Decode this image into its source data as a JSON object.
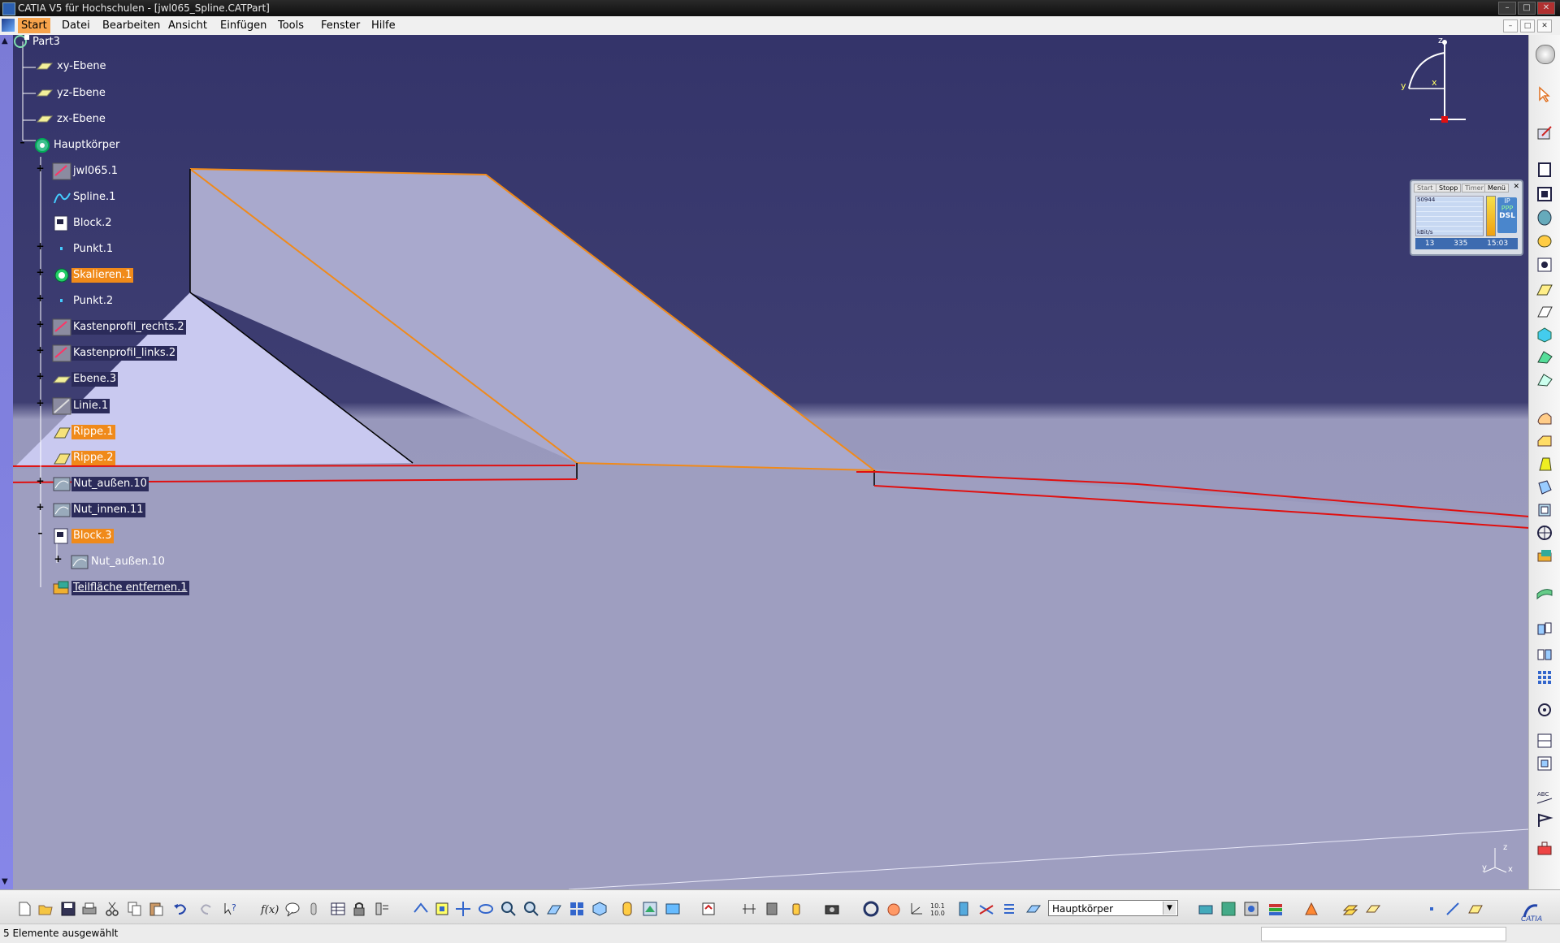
{
  "window": {
    "title": "CATIA V5 für Hochschulen - [jwl065_Spline.CATPart]",
    "controls": [
      "–",
      "□",
      "✕"
    ]
  },
  "menu": {
    "items": [
      "Start",
      "Datei",
      "Bearbeiten",
      "Ansicht",
      "Einfügen",
      "Tools",
      "Fenster",
      "Hilfe"
    ],
    "active": "Start",
    "mdi_controls": [
      "–",
      "□",
      "✕"
    ]
  },
  "tree": {
    "root": "Part3",
    "nodes": [
      {
        "label": "xy-Ebene",
        "icon": "plane-icon",
        "style": "plain"
      },
      {
        "label": "yz-Ebene",
        "icon": "plane-icon",
        "style": "plain"
      },
      {
        "label": "zx-Ebene",
        "icon": "plane-icon",
        "style": "plain"
      },
      {
        "label": "Hauptkörper",
        "icon": "body-icon",
        "style": "plain"
      },
      {
        "label": "jwl065.1",
        "icon": "sketch-icon",
        "style": "plain"
      },
      {
        "label": "Spline.1",
        "icon": "spline-icon",
        "style": "plain"
      },
      {
        "label": "Block.2",
        "icon": "pad-icon",
        "style": "plain"
      },
      {
        "label": "Punkt.1",
        "icon": "point-icon",
        "style": "plain"
      },
      {
        "label": "Skalieren.1",
        "icon": "scale-icon",
        "style": "orange"
      },
      {
        "label": "Punkt.2",
        "icon": "point-icon",
        "style": "plain"
      },
      {
        "label": "Kastenprofil_rechts.2",
        "icon": "sketch-icon",
        "style": "dark"
      },
      {
        "label": "Kastenprofil_links.2",
        "icon": "sketch-icon",
        "style": "dark"
      },
      {
        "label": "Ebene.3",
        "icon": "plane-icon",
        "style": "dark"
      },
      {
        "label": "Linie.1",
        "icon": "line-icon",
        "style": "dark"
      },
      {
        "label": "Rippe.1",
        "icon": "rib-icon",
        "style": "orange"
      },
      {
        "label": "Rippe.2",
        "icon": "rib-icon",
        "style": "orange"
      },
      {
        "label": "Nut_außen.10",
        "icon": "slot-icon",
        "style": "dark"
      },
      {
        "label": "Nut_innen.11",
        "icon": "slot-icon",
        "style": "dark"
      },
      {
        "label": "Block.3",
        "icon": "pad-icon",
        "style": "orange"
      },
      {
        "label": "Nut_außen.10",
        "icon": "slot-icon",
        "style": "plain"
      },
      {
        "label": "Teilfläche entfernen.1",
        "icon": "remove-face-icon",
        "style": "dark-underline"
      }
    ]
  },
  "compass": {
    "x_label": "x",
    "y_label": "y",
    "z_label": "z"
  },
  "mini_axis": {
    "z_label": "z",
    "y_label": "y",
    "x_label": "x"
  },
  "dsl_widget": {
    "tabs": [
      "Start",
      "Stopp",
      "Timer",
      "Menü"
    ],
    "graph_top_label": "50944",
    "graph_unit": "kBit/s",
    "badge_line1": "IP",
    "badge_line2": "PPP",
    "badge_line3": "DSL",
    "footer_down": "13",
    "footer_up": "335",
    "footer_time": "15:03"
  },
  "toolbar_bottom": {
    "body_combo_value": "Hauptkörper"
  },
  "status": {
    "text": "5 Elemente ausgewählt"
  },
  "colors": {
    "background_top": "#36366a",
    "background_bottom": "#9c9cbe",
    "face_light": "#c8c8ee",
    "face_mid": "#a8a8cc",
    "highlight_orange": "#f08a1a",
    "red_edge": "#e01010"
  }
}
